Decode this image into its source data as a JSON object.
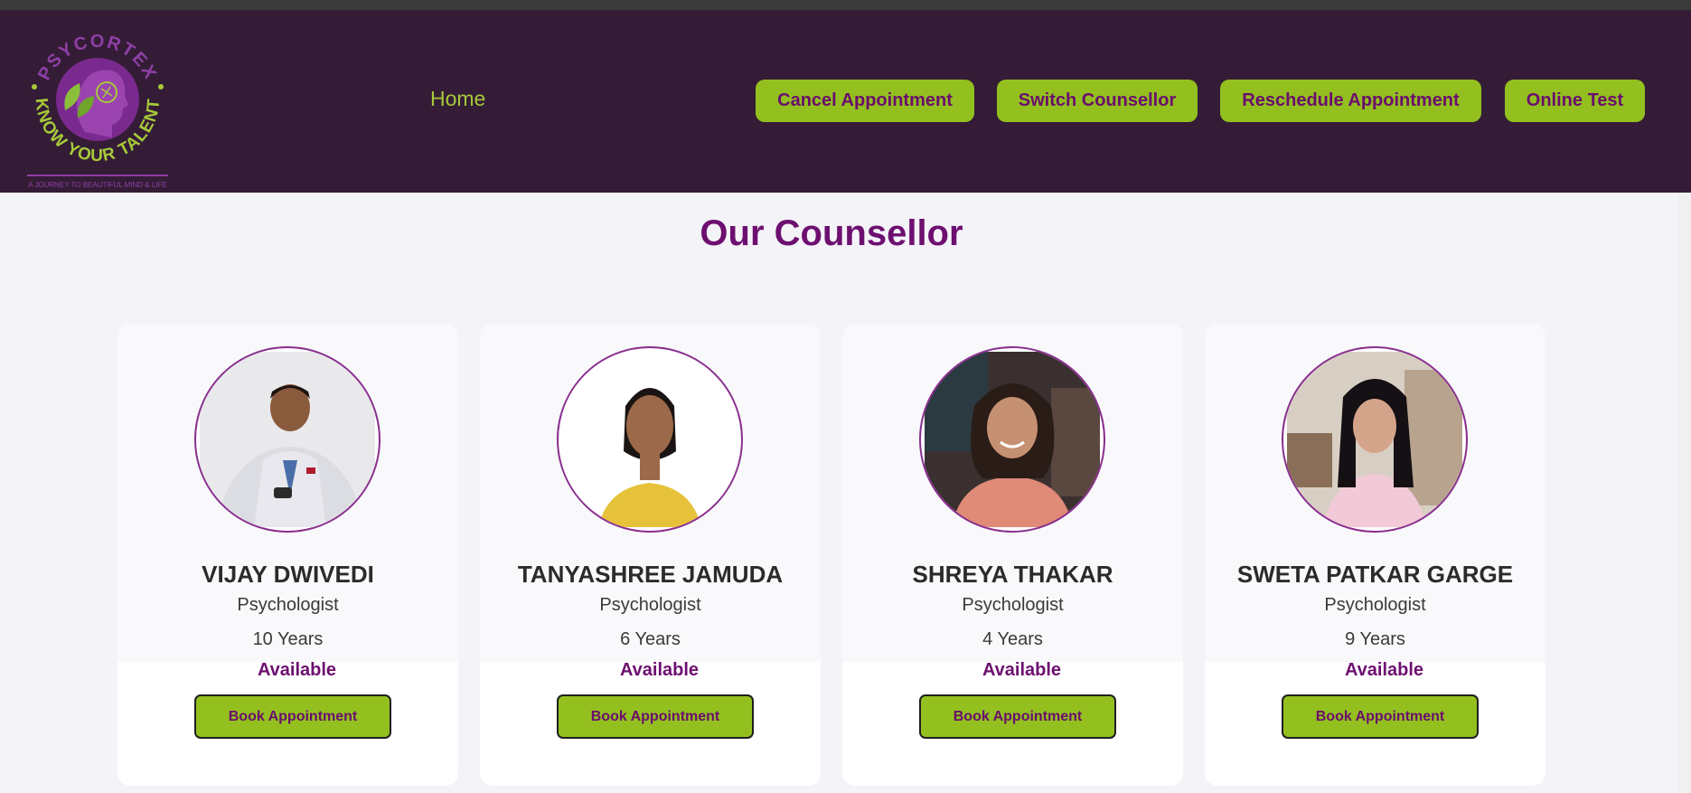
{
  "header": {
    "logo": {
      "brand_top": "PSYCORTEX",
      "brand_bottom": "KNOW YOUR TALENT",
      "tagline": "A JOURNEY TO BEAUTIFUL MIND & LIFE"
    },
    "home_label": "Home",
    "nav": {
      "cancel": "Cancel Appointment",
      "switch": "Switch Counsellor",
      "reschedule": "Reschedule Appointment",
      "test": "Online Test"
    }
  },
  "main": {
    "title": "Our Counsellor",
    "counsellors": [
      {
        "name": "VIJAY DWIVEDI",
        "role": "Psychologist",
        "experience": "10 Years",
        "status": "Available",
        "button": "Book Appointment"
      },
      {
        "name": "TANYASHREE JAMUDA",
        "role": "Psychologist",
        "experience": "6 Years",
        "status": "Available",
        "button": "Book Appointment"
      },
      {
        "name": "SHREYA THAKAR",
        "role": "Psychologist",
        "experience": "4 Years",
        "status": "Available",
        "button": "Book Appointment"
      },
      {
        "name": "SWETA PATKAR GARGE",
        "role": "Psychologist",
        "experience": "9 Years",
        "status": "Available",
        "button": "Book Appointment"
      }
    ]
  },
  "colors": {
    "header_bg": "#341c36",
    "accent_green": "#93c01f",
    "brand_purple": "#6d0f70"
  }
}
